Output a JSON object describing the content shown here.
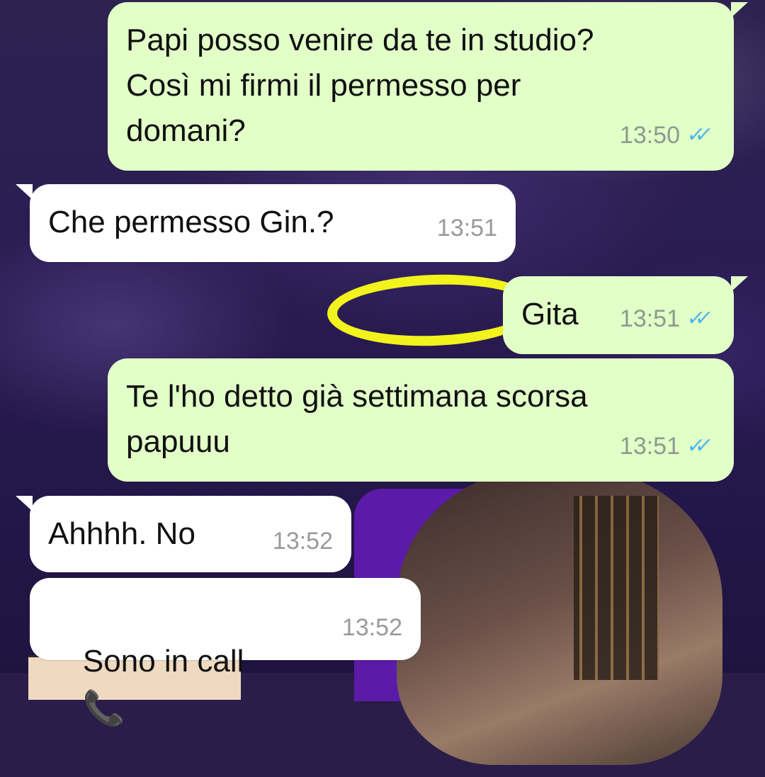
{
  "messages": [
    {
      "direction": "outgoing",
      "text": "Papi posso venire da te in studio?\nCosì mi firmi il permesso per\ndomani?",
      "time": "13:50",
      "status": "read"
    },
    {
      "direction": "incoming",
      "text": "Che permesso Gin.?",
      "time": "13:51"
    },
    {
      "direction": "outgoing",
      "text": "Gita",
      "time": "13:51",
      "status": "read"
    },
    {
      "direction": "outgoing",
      "text": "Te l'ho detto già settimana scorsa\npapuuu",
      "time": "13:51",
      "status": "read"
    },
    {
      "direction": "incoming",
      "text": "Ahhhh. No",
      "time": "13:52"
    },
    {
      "direction": "incoming",
      "text": "Sono in call",
      "time": "13:52",
      "icon": "telephone-icon"
    }
  ],
  "colors": {
    "outgoing_bubble": "#e2ffc8",
    "incoming_bubble": "#ffffff",
    "read_ticks": "#4fb6ec",
    "wallpaper": "#2a1d4a"
  },
  "glyphs": {
    "read_ticks": "✓✓",
    "telephone": "📞"
  }
}
